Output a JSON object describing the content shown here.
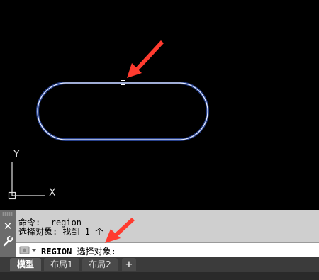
{
  "ucs": {
    "y_label": "Y",
    "x_label": "X"
  },
  "command_line": {
    "history": [
      "命令: _region",
      "选择对象: 找到 1 个"
    ],
    "prompt_command": "REGION",
    "prompt_text": " 选择对象:",
    "close_glyph": "✕"
  },
  "tabs": [
    {
      "label": "模型",
      "active": true
    },
    {
      "label": "布局1",
      "active": false
    },
    {
      "label": "布局2",
      "active": false
    },
    {
      "label": "+",
      "active": false
    }
  ],
  "colors": {
    "canvas": "#000000",
    "shape_stroke": "#dfe6ff",
    "shape_glow": "#4a78ff",
    "annotation_arrow": "#ff3b2f",
    "ucs": "#e0e0e0"
  },
  "icons": [
    "close-icon",
    "wrench-icon",
    "recent-commands-icon",
    "grip-icon"
  ]
}
